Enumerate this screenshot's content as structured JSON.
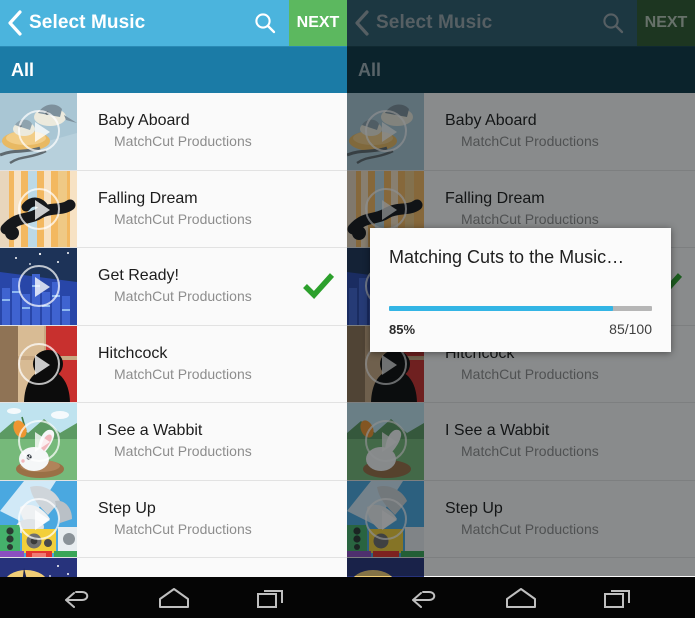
{
  "app": {
    "actionbar": {
      "back_icon": "back-chevron-icon",
      "title": "Select Music",
      "search_icon": "search-icon",
      "next_label": "NEXT",
      "accent_color": "#4bb4dd",
      "next_color": "#5cb85f"
    },
    "tabbar": {
      "label": "All",
      "color": "#1b7ba6"
    },
    "navbar": {
      "back_icon": "android-back-icon",
      "home_icon": "android-home-icon",
      "recents_icon": "android-recents-icon"
    }
  },
  "list": {
    "items": [
      {
        "title": "Baby Aboard",
        "artist": "MatchCut Productions",
        "selected": false,
        "thumb": "birds-nest-thumbnail"
      },
      {
        "title": "Falling Dream",
        "artist": "MatchCut Productions",
        "selected": false,
        "thumb": "falling-person-thumbnail"
      },
      {
        "title": "Get Ready!",
        "artist": "MatchCut Productions",
        "selected": true,
        "thumb": "equalizer-night-thumbnail"
      },
      {
        "title": "Hitchcock",
        "artist": "MatchCut Productions",
        "selected": false,
        "thumb": "silhouette-thumbnail"
      },
      {
        "title": "I See a Wabbit",
        "artist": "MatchCut Productions",
        "selected": false,
        "thumb": "rabbit-carrot-thumbnail"
      },
      {
        "title": "Step Up",
        "artist": "MatchCut Productions",
        "selected": false,
        "thumb": "sneakers-speakers-thumbnail"
      },
      {
        "title": "",
        "artist": "",
        "selected": false,
        "thumb": "night-sky-thumbnail"
      }
    ],
    "selected_icon": "green-check-icon",
    "selected_color": "#2ca02c",
    "play_overlay_icon": "play-circle-icon"
  },
  "dialog": {
    "title": "Matching Cuts to the Music…",
    "percent_label": "85%",
    "fraction_label": "85/100",
    "progress_value": 85,
    "progress_max": 100,
    "progress_color": "#33b5e5",
    "track_color": "#b6b6b6"
  }
}
